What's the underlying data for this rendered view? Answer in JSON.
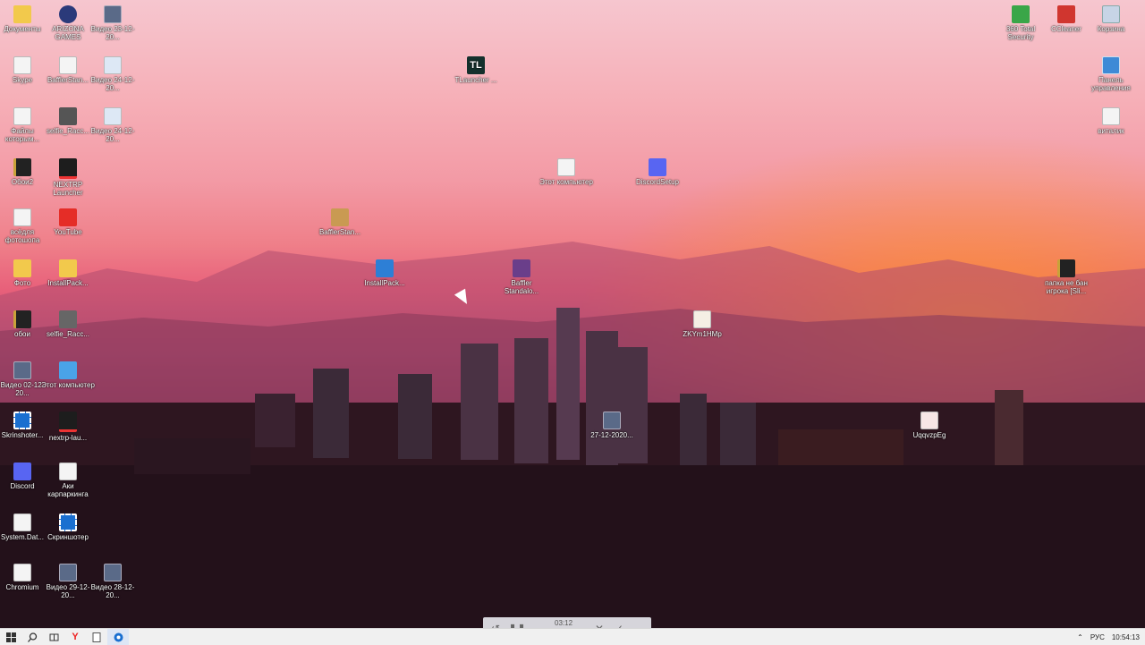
{
  "desktop": {
    "icons": [
      {
        "label": "Документы"
      },
      {
        "label": "ARIZONA GAMES"
      },
      {
        "label": "Видео 23-12-20..."
      },
      {
        "label": "Skype"
      },
      {
        "label": "BafflerStan..."
      },
      {
        "label": "Видео 24-12-20..."
      },
      {
        "label": "Файлы которым..."
      },
      {
        "label": "selfie_Racc..."
      },
      {
        "label": "Видео 24-12-20..."
      },
      {
        "label": "Обои2"
      },
      {
        "label": "NEXTRP Launcher"
      },
      {
        "label": "всёдля фотошопа"
      },
      {
        "label": "YouTube"
      },
      {
        "label": "Фото"
      },
      {
        "label": "InstallPack..."
      },
      {
        "label": "обои"
      },
      {
        "label": "selfie_Racc..."
      },
      {
        "label": "Видео 02-12-20..."
      },
      {
        "label": "Этот компьютер"
      },
      {
        "label": "Skrinshoter..."
      },
      {
        "label": "nextrp-lau..."
      },
      {
        "label": "Discord"
      },
      {
        "label": "Аки карпаркинга"
      },
      {
        "label": "System.Dat..."
      },
      {
        "label": "Скриншотер"
      },
      {
        "label": "Chromium"
      },
      {
        "label": "Видео 29-12-20..."
      },
      {
        "label": "Видео 28-12-20..."
      },
      {
        "label": "TLauncher ..."
      },
      {
        "label": "BafflerStan..."
      },
      {
        "label": "InstallPack..."
      },
      {
        "label": "Baffler Standalo..."
      },
      {
        "label": "Этот компьютер"
      },
      {
        "label": "DiscordSetup"
      },
      {
        "label": "ZKYm1HMp"
      },
      {
        "label": "27-12-2020..."
      },
      {
        "label": "UqqvzpEg"
      },
      {
        "label": "360 Total Security"
      },
      {
        "label": "CCleaner"
      },
      {
        "label": "Корзина"
      },
      {
        "label": "Панель управления"
      },
      {
        "label": "виталик"
      },
      {
        "label": "папка не бан игрока [Sli..."
      }
    ]
  },
  "recorder": {
    "time": "03:12",
    "progress": 0.08
  },
  "taskbar": {
    "language": "РУС",
    "clock": "10:54:13"
  }
}
